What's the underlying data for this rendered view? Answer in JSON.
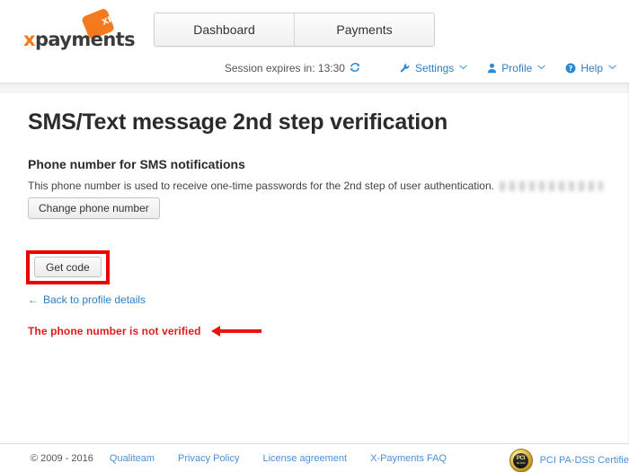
{
  "header": {
    "logo": {
      "text_first": "x",
      "text_rest": "payments",
      "tag_label": "XP"
    },
    "tabs": [
      {
        "label": "Dashboard",
        "name": "tab-dashboard"
      },
      {
        "label": "Payments",
        "name": "tab-payments"
      }
    ],
    "session": {
      "label": "Session expires in:",
      "time": "13:30",
      "refresh_icon": "refresh-icon"
    },
    "menus": [
      {
        "label": "Settings",
        "icon": "wrench-icon",
        "caret": "⌄"
      },
      {
        "label": "Profile",
        "icon": "user-icon",
        "caret": "⌄"
      },
      {
        "label": "Help",
        "icon": "question-circle-icon",
        "caret": "⌄"
      }
    ]
  },
  "main": {
    "page_title": "SMS/Text message 2nd step verification",
    "section_title": "Phone number for SMS notifications",
    "description": "This phone number is used to receive one-time passwords for the 2nd step of user authentication.",
    "phone_number_masked": "",
    "change_phone_button": "Change phone number",
    "warning_text": "The phone number is not verified",
    "get_code_button": "Get code",
    "back_link": {
      "arrow": "←",
      "label": "Back to profile details"
    }
  },
  "footer": {
    "copyright": "© 2009 - 2016",
    "links": [
      "Qualiteam",
      "Privacy Policy",
      "License agreement",
      "X-Payments FAQ"
    ],
    "pci": {
      "badge_line1": "PCI",
      "badge_line2": "PA-DSS",
      "text": "PCI PA-DSS Certifie"
    }
  },
  "colors": {
    "brand_orange": "#f47a20",
    "link_blue": "#2b7fc4",
    "warning_red": "#e01b1b",
    "annotation_red": "#ee0000"
  }
}
